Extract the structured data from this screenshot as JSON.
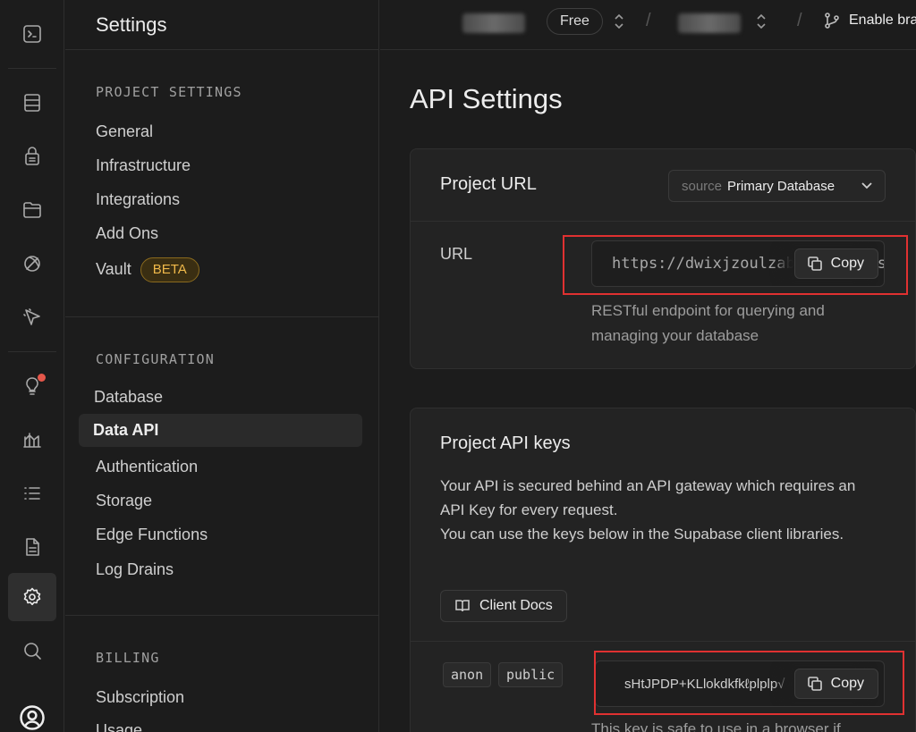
{
  "sidebar": {
    "title": "Settings",
    "groups": [
      {
        "title": "PROJECT SETTINGS",
        "items": [
          "General",
          "Infrastructure",
          "Integrations",
          "Add Ons",
          "Vault"
        ]
      },
      {
        "title": "CONFIGURATION",
        "items": [
          "Database",
          "Data API",
          "Authentication",
          "Storage",
          "Edge Functions",
          "Log Drains"
        ]
      },
      {
        "title": "BILLING",
        "items": [
          "Subscription",
          "Usage"
        ]
      }
    ],
    "vault_badge": "BETA",
    "active_item": "Data API"
  },
  "rail": {
    "icons": [
      "terminal-icon",
      "table-editor-icon",
      "auth-icon",
      "storage-icon",
      "realtime-icon",
      "cursor-icon",
      "advisor-icon",
      "reports-icon",
      "logs-icon",
      "docs-icon",
      "settings-icon",
      "search-icon",
      "user-avatar-icon"
    ],
    "active": "settings-icon",
    "notification_color": "#e5574a"
  },
  "topbar": {
    "plan": "Free",
    "separator": "/",
    "branch_label": "Enable branching"
  },
  "main": {
    "title": "API Settings",
    "project_url": {
      "title": "Project URL",
      "source_prefix": "source",
      "source_value": "Primary Database",
      "url_label": "URL",
      "url_value": "https://dwixjzoulzabcdefghij.supabase.co",
      "copy_label": "Copy",
      "hint": "RESTful endpoint for querying and managing your database"
    },
    "api_keys": {
      "title": "Project API keys",
      "description_1": "Your API is secured behind an API gateway which requires an API Key for every request.",
      "description_2": "You can use the keys below in the Supabase client libraries.",
      "docs_label": "Client Docs",
      "anon_badge": "anon",
      "public_badge": "public",
      "anon_key": "sHtJPDP+KLlokdkfkℓplplp√",
      "copy_label": "Copy",
      "hint": "This key is safe to use in a browser if"
    }
  },
  "colors": {
    "background": "#1c1c1c",
    "card": "#232323",
    "beta": "#f0b94a",
    "highlight": "#e03131"
  }
}
